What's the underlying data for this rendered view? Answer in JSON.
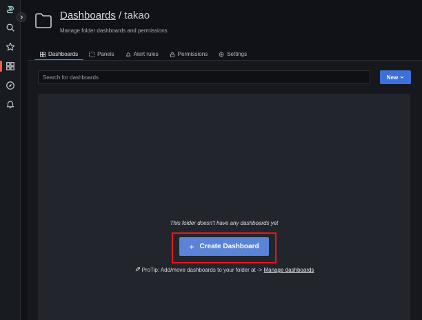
{
  "sidebar": {
    "items": [
      {
        "icon": "logo-icon"
      },
      {
        "icon": "search-icon"
      },
      {
        "icon": "star-icon"
      },
      {
        "icon": "dashboards-icon"
      },
      {
        "icon": "explore-icon"
      },
      {
        "icon": "alerting-icon"
      }
    ],
    "active_accent": "#f55f3e"
  },
  "header": {
    "breadcrumb_link": "Dashboards",
    "separator": " / ",
    "folder_name": "takao",
    "subtitle": "Manage folder dashboards and permissions"
  },
  "tabs": [
    {
      "label": "Dashboards",
      "icon": "apps-icon",
      "active": true
    },
    {
      "label": "Panels",
      "icon": "panels-icon",
      "active": false
    },
    {
      "label": "Alert rules",
      "icon": "bell-icon",
      "active": false
    },
    {
      "label": "Permissions",
      "icon": "lock-icon",
      "active": false
    },
    {
      "label": "Settings",
      "icon": "cog-icon",
      "active": false
    }
  ],
  "search": {
    "placeholder": "Search for dashboards",
    "value": ""
  },
  "new_button": {
    "label": "New",
    "color": "#3d71d9"
  },
  "empty_state": {
    "message": "This folder doesn't have any dashboards yet",
    "create_label": "Create Dashboard",
    "create_color": "#5b84d8",
    "protip_text": "ProTip: Add/move dashboards to your folder at -> ",
    "protip_link": "Manage dashboards",
    "highlight_color": "#e8191a"
  }
}
